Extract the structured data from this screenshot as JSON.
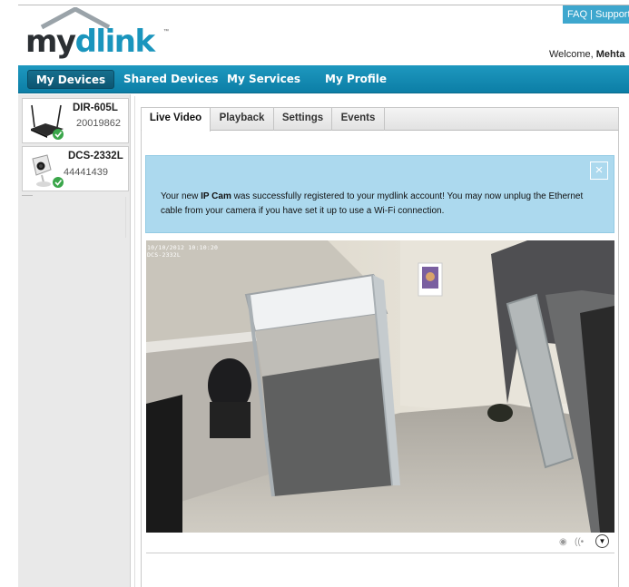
{
  "brand": {
    "logo_my": "my",
    "logo_dlink": "dlink",
    "tm": "™"
  },
  "topbar": {
    "faq": "FAQ",
    "sep": "|",
    "support": "Support",
    "welcome_prefix": "Welcome,",
    "user": "Mehta"
  },
  "nav": {
    "items": [
      "My Devices",
      "Shared Devices",
      "My Services",
      "My Profile"
    ],
    "active": "My Devices"
  },
  "devices": [
    {
      "name": "DIR-605L",
      "serial": "20019862",
      "status": "online"
    },
    {
      "name": "DCS-2332L",
      "serial": "44441439",
      "status": "online"
    }
  ],
  "tabs": [
    "Live Video",
    "Playback",
    "Settings",
    "Events"
  ],
  "active_tab": "Live Video",
  "notice": {
    "text_before": "Your new ",
    "bold": "IP Cam",
    "text_after": " was successfully registered to your mydlink account! You may now unplug the Ethernet cable from your camera if you have set it up to use a Wi-Fi connection.",
    "close": "×"
  },
  "video": {
    "timestamp": "10/10/2012 10:10:20",
    "camera": "DCS-2332L"
  },
  "controls": {
    "record": "◉",
    "audio": "((•",
    "more": "▼"
  },
  "colors": {
    "accent": "#1a95bd",
    "nav": "#0c7ea6",
    "notice": "#acd9ee"
  }
}
